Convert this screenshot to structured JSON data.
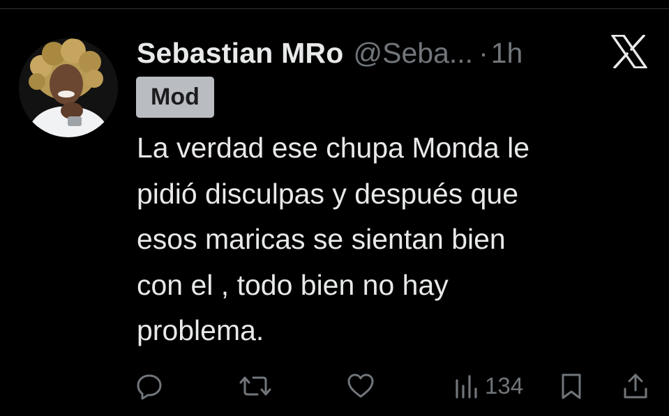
{
  "tweet": {
    "author_name": "Sebastian MRo",
    "author_handle": "@Seba...",
    "separator": "·",
    "timestamp": "1h",
    "badge": "Mod",
    "text": "La verdad ese chupa Monda le\npidió disculpas y después que\nesos maricas se sientan bien\ncon el , todo bien no hay\nproblema."
  },
  "actions": {
    "reply_icon": "reply-icon",
    "retweet_icon": "retweet-icon",
    "like_icon": "like-icon",
    "views_icon": "views-icon",
    "views_count": "134",
    "bookmark_icon": "bookmark-icon",
    "share_icon": "share-icon"
  },
  "colors": {
    "background": "#000000",
    "text_primary": "#e7e9ea",
    "text_secondary": "#71767b",
    "badge_background": "#b9bcc0",
    "divider": "#2f3336"
  }
}
